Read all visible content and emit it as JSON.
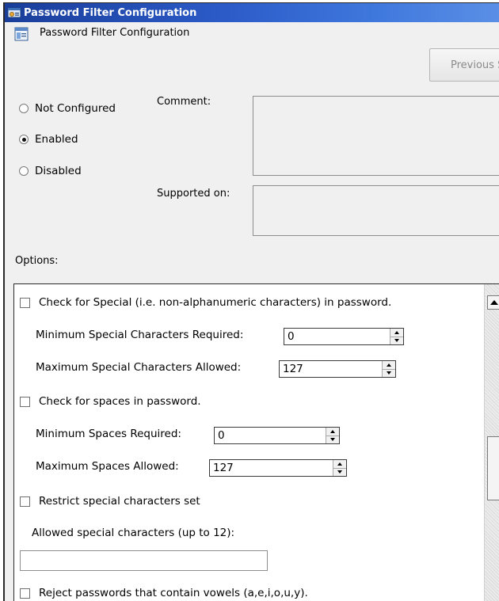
{
  "window": {
    "title": "Password Filter Configuration"
  },
  "header": {
    "title": "Password Filter Configuration",
    "previous_button": "Previous S"
  },
  "state": {
    "options": [
      {
        "label": "Not Configured",
        "selected": false
      },
      {
        "label": "Enabled",
        "selected": true
      },
      {
        "label": "Disabled",
        "selected": false
      }
    ]
  },
  "labels": {
    "comment": "Comment:",
    "supported_on": "Supported on:",
    "options": "Options:"
  },
  "options_panel": {
    "special_check": {
      "label": "Check for Special (i.e. non-alphanumeric characters) in password.",
      "checked": false
    },
    "min_special": {
      "label": "Minimum Special Characters Required:",
      "value": "0"
    },
    "max_special": {
      "label": "Maximum Special Characters Allowed:",
      "value": "127"
    },
    "spaces_check": {
      "label": "Check for spaces in password.",
      "checked": false
    },
    "min_spaces": {
      "label": "Minimum Spaces Required:",
      "value": "0"
    },
    "max_spaces": {
      "label": "Maximum Spaces Allowed:",
      "value": "127"
    },
    "restrict_check": {
      "label": "Restrict special characters set",
      "checked": false
    },
    "allowed_special": {
      "label": "Allowed special characters (up to 12):",
      "value": ""
    },
    "vowels_check": {
      "label": "Reject passwords that contain vowels (a,e,i,o,u,y).",
      "checked": false
    }
  }
}
